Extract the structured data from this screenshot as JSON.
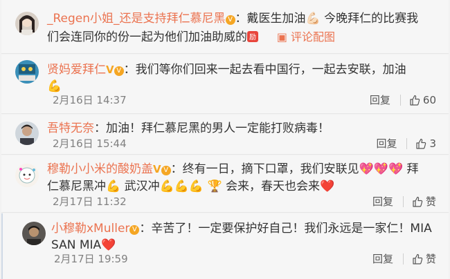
{
  "comments": [
    {
      "username": "_Regen小姐_还是支持拜仁慕尼黑",
      "line1": "：戴医生加油💪🏻 今晚拜仁的比赛我",
      "line2": "们会连同你的份一起为他们加油助威的",
      "pic_comment_label": "评论配图"
    },
    {
      "username": "贤妈爱拜仁",
      "line1": "：我们等你们回来一起去看中国行，一起去安联，加油",
      "line2": "💪",
      "date": "2月16日 14:37",
      "reply_label": "回复",
      "likes": "60"
    },
    {
      "username": "吾特无奈",
      "line1": "：加油！拜仁慕尼黑的男人一定能打败病毒！",
      "date": "2月16日 15:44",
      "reply_label": "回复",
      "likes": "3"
    },
    {
      "username": "穆勒小小米的酸奶盖",
      "line1": "：终有一日，摘下口罩，我们安联见💖💖💖 拜",
      "line2": "仁慕尼黑冲💪 武汉冲💪💪💪 🏆 会来，春天也会来❤️",
      "date": "2月17日 11:32",
      "reply_label": "回复",
      "likes": "赞"
    },
    {
      "username": "小穆勒xMuller",
      "line1": "：辛苦了！一定要保护好自己！我们永远是一家仁！MIA",
      "line2": "SAN MIA❤️",
      "date": "2月17日 19:59",
      "reply_label": "回复",
      "likes": "赞"
    }
  ],
  "colors": {
    "username": "#eb7350",
    "text": "#333333",
    "meta": "#808080",
    "background": "#f6f6f6"
  }
}
